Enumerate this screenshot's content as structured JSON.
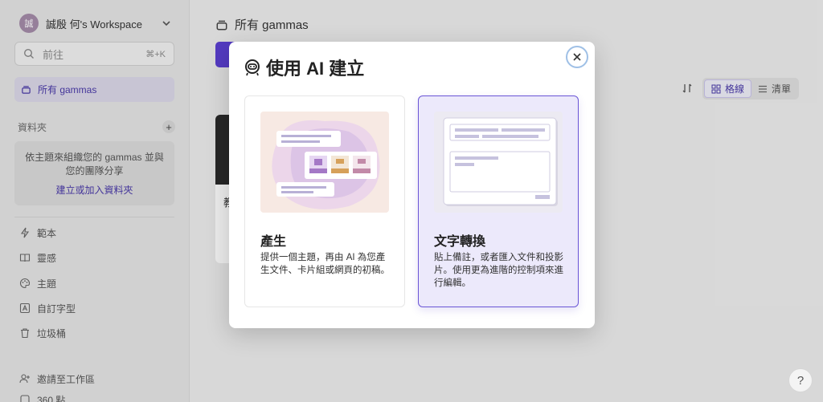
{
  "workspace": {
    "avatar_text": "誠",
    "name": "誠殷 何's Workspace"
  },
  "search": {
    "placeholder": "前往",
    "shortcut": "⌘+K"
  },
  "sidebar": {
    "active_item": "所有 gammas",
    "folders_header": "資料夾",
    "folders_desc": "依主題來組織您的 gammas 並與您的團隊分享",
    "folders_link": "建立或加入資料夾",
    "items": [
      {
        "label": "範本",
        "icon": "bolt-icon"
      },
      {
        "label": "靈感",
        "icon": "book-icon"
      },
      {
        "label": "主題",
        "icon": "palette-icon"
      },
      {
        "label": "自訂字型",
        "icon": "font-icon"
      },
      {
        "label": "垃圾桶",
        "icon": "trash-icon"
      }
    ],
    "invite": "邀請至工作區",
    "points": "360 點"
  },
  "main": {
    "title": "所有 gammas",
    "card_title_partial": "教",
    "view_grid": "格線",
    "view_list": "清單"
  },
  "modal": {
    "title": "使用 AI 建立",
    "options": [
      {
        "title": "產生",
        "desc": "提供一個主題，再由 AI 為您產生文件、卡片組或網頁的初稿。"
      },
      {
        "title": "文字轉換",
        "desc": "貼上備註，或者匯入文件和投影片。使用更為進階的控制項來進行編輯。"
      }
    ]
  },
  "help_label": "?",
  "colors": {
    "accent": "#5b3fd1",
    "selected_card_bg": "#ece9fb"
  }
}
